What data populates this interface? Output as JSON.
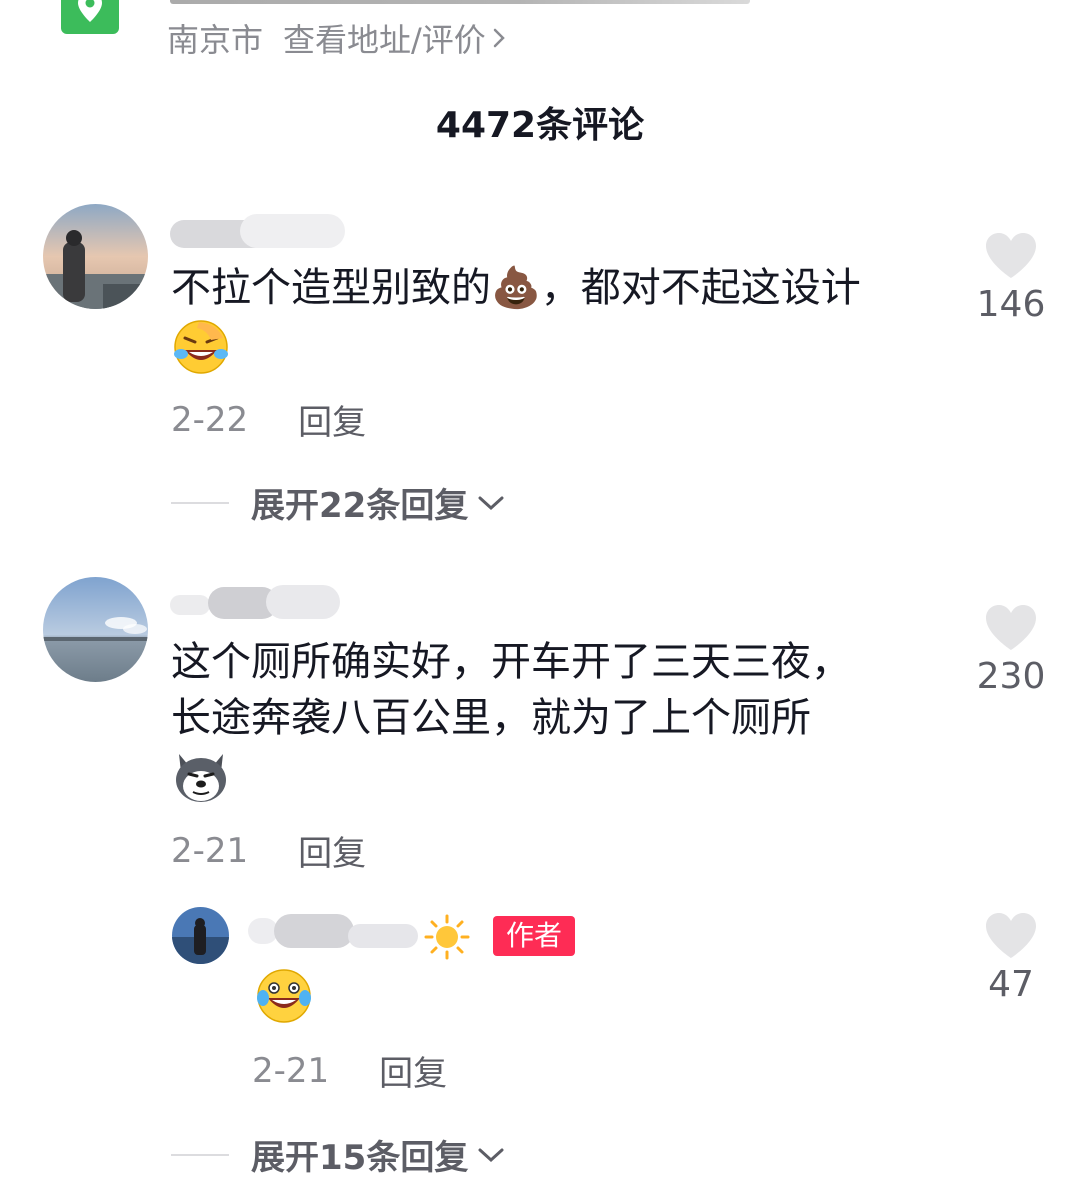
{
  "location": {
    "city": "南京市",
    "link_label": "查看地址/评价"
  },
  "comments_header": {
    "title": "4472条评论"
  },
  "comments": [
    {
      "text": "不拉个造型别致的💩，都对不起这设计",
      "emoji_line": "laugh-cry-emoji",
      "date": "2-22",
      "reply_label": "回复",
      "likes": "146",
      "expand_label": "展开22条回复"
    },
    {
      "text_line1": "这个厕所确实好，开车开了三天三夜，",
      "text_line2": "长途奔袭八百公里，就为了上个厕所",
      "emoji_line": "husky-dog-emoji",
      "date": "2-21",
      "reply_label": "回复",
      "likes": "230",
      "sub_reply": {
        "badge": "作者",
        "emoji": "tears-of-joy-emoji",
        "date": "2-21",
        "reply_label": "回复",
        "likes": "47"
      },
      "expand_label": "展开15条回复"
    }
  ],
  "colors": {
    "accent_red": "#fe2c55",
    "map_green": "#3cbc5b",
    "muted_text": "#8a8b91",
    "like_gray": "#e4e4e6"
  }
}
